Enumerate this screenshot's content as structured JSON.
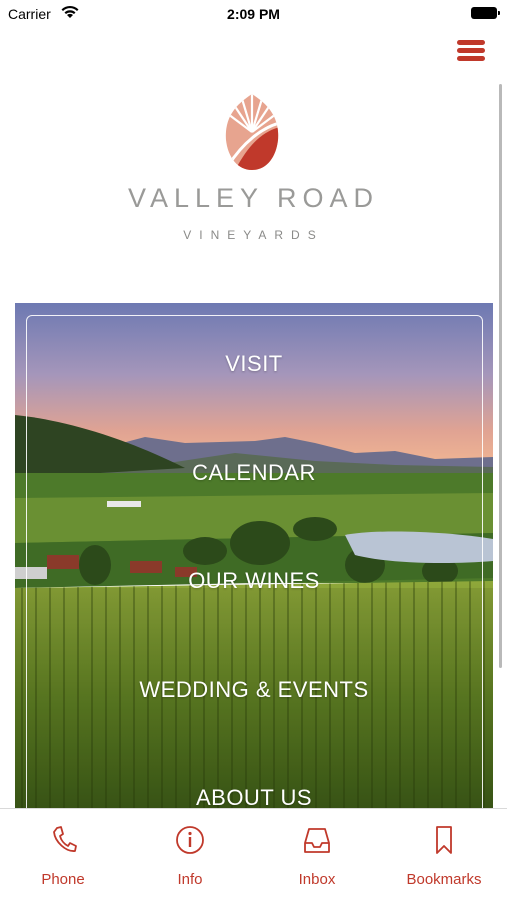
{
  "status_bar": {
    "carrier": "Carrier",
    "time": "2:09 PM"
  },
  "brand": {
    "name": "VALLEY ROAD",
    "subtitle": "VINEYARDS"
  },
  "nav": [
    {
      "label": "VISIT"
    },
    {
      "label": "CALENDAR"
    },
    {
      "label": "OUR WINES"
    },
    {
      "label": "WEDDING & EVENTS"
    },
    {
      "label": "ABOUT US"
    }
  ],
  "tabs": [
    {
      "label": "Phone",
      "icon": "phone-icon"
    },
    {
      "label": "Info",
      "icon": "info-icon"
    },
    {
      "label": "Inbox",
      "icon": "inbox-icon"
    },
    {
      "label": "Bookmarks",
      "icon": "bookmark-icon"
    }
  ],
  "colors": {
    "accent": "#c0392b",
    "brand_text": "#9a9a98"
  }
}
